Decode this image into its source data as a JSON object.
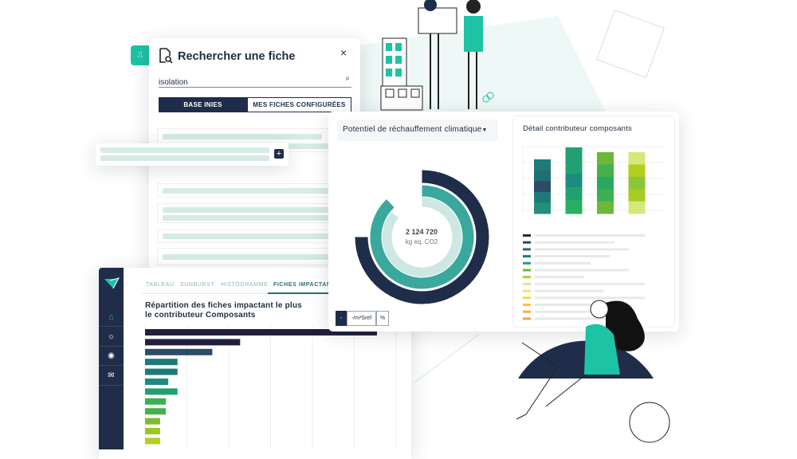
{
  "search_panel": {
    "title": "Rechercher une fiche",
    "search_value": "isolation",
    "tabs": [
      {
        "label": "BASE INIES",
        "active": true
      },
      {
        "label": "MES FICHES CONFIGURÉES",
        "active": false
      }
    ]
  },
  "impact_panel": {
    "indicator_select": "Potentiel de réchauffement climatique",
    "donut_value": "2 124 720",
    "donut_unit": "kg eq. CO2",
    "unit_toggle": [
      "-",
      "-/m²Sref",
      "%"
    ],
    "detail_title": "Détail contributeur composants",
    "stack_colors": [
      [
        "#1f7a78",
        "#236e74",
        "#2d4a68",
        "#1e7a78",
        "#23907a"
      ],
      [
        "#22a070",
        "#22a070",
        "#1f8a80",
        "#22a070",
        "#28b060"
      ],
      [
        "#6cb83a",
        "#46b04a",
        "#2aa860",
        "#3bb050",
        "#6cb83a"
      ],
      [
        "#d6e87a",
        "#b3cf1e",
        "#8cc43a",
        "#a7cc20",
        "#d6e87a"
      ]
    ],
    "legend_colors": [
      "#1f2d3d",
      "#2d4a68",
      "#236e74",
      "#1e7a78",
      "#23a070",
      "#6cb83a",
      "#b3cf1e",
      "#d6e8a0",
      "#f5e27a",
      "#f7d54a",
      "#f5c542",
      "#f5b04a",
      "#f5a04a"
    ]
  },
  "app": {
    "nav_icons": [
      "home-icon",
      "lightbulb-icon",
      "user-circle-icon",
      "mail-icon"
    ],
    "tabs": [
      {
        "label": "TABLEAU"
      },
      {
        "label": "SUNBURST"
      },
      {
        "label": "HISTOGRAMME"
      },
      {
        "label": "FICHES IMPACTANTES",
        "active": true
      }
    ],
    "chart_title_line1": "Répartition des fiches impactant le plus",
    "chart_title_line2": "le contributeur Composants"
  },
  "colors": {
    "navy": "#1f2d4a",
    "teal": "#3aa89c",
    "accent": "#1cc3a5"
  },
  "chart_data": [
    {
      "type": "bar",
      "orientation": "horizontal",
      "title": "Répartition des fiches impactant le plus le contributeur Composants",
      "values": [
        100,
        41,
        29,
        14,
        14,
        10,
        14,
        9,
        9,
        6.5,
        6.5,
        6.5
      ],
      "colors": [
        "#221f3d",
        "#221f3d",
        "#2d4a68",
        "#1e7a78",
        "#1e7a78",
        "#1f8a80",
        "#23a070",
        "#3bb050",
        "#46b04a",
        "#7cbc30",
        "#9cc620",
        "#b3cf1e"
      ],
      "grid": true
    },
    {
      "type": "pie",
      "subtype": "multi-ring donut",
      "center_label": "2 124 720 kg eq. CO2",
      "rings": [
        {
          "fraction": 0.75,
          "color": "#1f2d4a"
        },
        {
          "fraction": 0.88,
          "color": "#3aa89c"
        },
        {
          "fraction": 0.86,
          "color": "#cde8e3"
        }
      ]
    }
  ]
}
